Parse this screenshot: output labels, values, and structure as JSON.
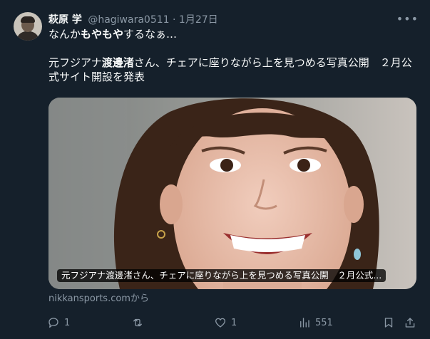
{
  "author": {
    "name": "萩原 学",
    "handle": "@hagiwara0511",
    "separator": "·",
    "date": "1月27日"
  },
  "tweet": {
    "line1_pre": "なんか",
    "line1_bold": "もやもや",
    "line1_post": "するなぁ…",
    "line2_pre": "元フジアナ",
    "line2_bold": "渡邊渚",
    "line2_post": "さん、チェアに座りながら上を見つめる写真公開　２月公",
    "line3": "式サイト開設を発表"
  },
  "card": {
    "caption": "元フジアナ渡邊渚さん、チェアに座りながら上を見つめる写真公開　２月公式...",
    "source": "nikkansports.comから"
  },
  "actions": {
    "reply_count": "1",
    "retweet_count": "",
    "like_count": "1",
    "views_count": "551"
  },
  "icons": {
    "menu": "more-dots-icon",
    "reply": "reply-bubble-icon",
    "retweet": "retweet-icon",
    "like": "heart-icon",
    "views": "analytics-bars-icon",
    "bookmark": "bookmark-icon",
    "share": "share-icon"
  },
  "colors": {
    "background": "#15202b",
    "text_primary": "#f7f9f9",
    "text_secondary": "#8b98a5"
  }
}
